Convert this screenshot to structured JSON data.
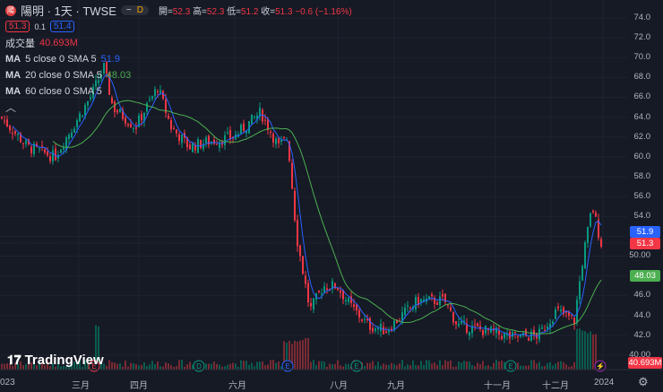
{
  "header": {
    "title": "陽明 · 1天 · TWSE",
    "logo": "陽",
    "pill_dash": "−",
    "pill_d": "D",
    "ohlc": {
      "o_label": "開=",
      "o": "52.3",
      "h_label": "高=",
      "h": "52.3",
      "l_label": "低=",
      "l": "51.2",
      "c_label": "收=",
      "c": "51.3",
      "chg": "−0.6 (−1.16%)"
    },
    "bid": "51.3",
    "spread": "0.1",
    "ask": "51.4"
  },
  "indicators": [
    {
      "label": "成交量",
      "value": "40.693M"
    },
    {
      "name": "MA",
      "params": "5 close 0 SMA 5",
      "value": "51.9"
    },
    {
      "name": "MA",
      "params": "20 close 0 SMA 5",
      "value": "48.03"
    },
    {
      "name": "MA",
      "params": "60 close 0 SMA 5",
      "value": ""
    }
  ],
  "price_axis": [
    "74.0",
    "72.0",
    "70.0",
    "68.0",
    "66.0",
    "64.0",
    "62.0",
    "60.0",
    "58.0",
    "56.0",
    "54.0",
    "52.0",
    "50.00",
    "48.0",
    "46.0",
    "44.0",
    "42.0",
    "40.00"
  ],
  "price_tags": {
    "ma5": "51.9",
    "last": "51.3",
    "ma20": "48.03",
    "volume": "40.693M"
  },
  "time_axis": [
    "023",
    "三月",
    "四月",
    "六月",
    "八月",
    "九月",
    "十一月",
    "十二月",
    "2024"
  ],
  "brand": "TradingView",
  "colors": {
    "up": "#089981",
    "down": "#f23645",
    "ma5": "#2962ff",
    "ma20": "#4caf50",
    "bg": "#161a25"
  },
  "chart_data": {
    "type": "candlestick",
    "symbol": "陽明",
    "interval": "1D",
    "ylim": [
      40,
      74
    ],
    "close_path": [
      [
        0,
        64
      ],
      [
        30,
        61
      ],
      [
        60,
        60
      ],
      [
        80,
        63
      ],
      [
        100,
        66
      ],
      [
        115,
        69
      ],
      [
        125,
        65
      ],
      [
        150,
        63
      ],
      [
        175,
        67
      ],
      [
        190,
        63
      ],
      [
        210,
        61
      ],
      [
        230,
        61.5
      ],
      [
        260,
        62
      ],
      [
        290,
        64.5
      ],
      [
        310,
        61
      ],
      [
        320,
        62
      ],
      [
        330,
        52
      ],
      [
        340,
        47
      ],
      [
        345,
        44.5
      ],
      [
        360,
        47
      ],
      [
        375,
        47
      ],
      [
        390,
        45
      ],
      [
        410,
        43
      ],
      [
        430,
        42.5
      ],
      [
        465,
        45.5
      ],
      [
        495,
        45.5
      ],
      [
        510,
        43
      ],
      [
        540,
        42.5
      ],
      [
        570,
        41.8
      ],
      [
        600,
        42
      ],
      [
        620,
        44.5
      ],
      [
        640,
        43.5
      ],
      [
        650,
        50
      ],
      [
        660,
        55
      ],
      [
        670,
        51.3
      ]
    ],
    "events": [
      "E",
      "D",
      "E",
      "E",
      "E",
      "⚡"
    ]
  }
}
